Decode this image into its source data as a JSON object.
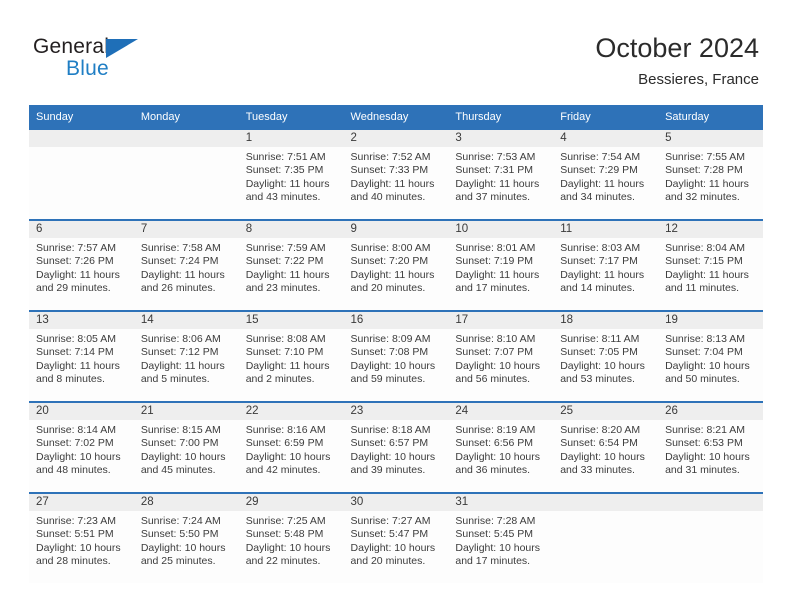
{
  "brand": {
    "name_top": "General",
    "name_bottom": "Blue",
    "triangle_color": "#1f6fb8",
    "blue_text_color": "#1f7ec4"
  },
  "header": {
    "title": "October 2024",
    "subtitle": "Bessieres, France"
  },
  "theme": {
    "header_blue": "#2e72b8",
    "row_divider": "#2e72b8",
    "daynum_band": "#eeeeee",
    "cell_bg": "#fdfdfd"
  },
  "weekday_headers": [
    "Sunday",
    "Monday",
    "Tuesday",
    "Wednesday",
    "Thursday",
    "Friday",
    "Saturday"
  ],
  "weeks": [
    [
      {
        "day": "",
        "empty": true
      },
      {
        "day": "",
        "empty": true
      },
      {
        "day": "1",
        "sunrise": "Sunrise: 7:51 AM",
        "sunset": "Sunset: 7:35 PM",
        "daylight1": "Daylight: 11 hours",
        "daylight2": "and 43 minutes."
      },
      {
        "day": "2",
        "sunrise": "Sunrise: 7:52 AM",
        "sunset": "Sunset: 7:33 PM",
        "daylight1": "Daylight: 11 hours",
        "daylight2": "and 40 minutes."
      },
      {
        "day": "3",
        "sunrise": "Sunrise: 7:53 AM",
        "sunset": "Sunset: 7:31 PM",
        "daylight1": "Daylight: 11 hours",
        "daylight2": "and 37 minutes."
      },
      {
        "day": "4",
        "sunrise": "Sunrise: 7:54 AM",
        "sunset": "Sunset: 7:29 PM",
        "daylight1": "Daylight: 11 hours",
        "daylight2": "and 34 minutes."
      },
      {
        "day": "5",
        "sunrise": "Sunrise: 7:55 AM",
        "sunset": "Sunset: 7:28 PM",
        "daylight1": "Daylight: 11 hours",
        "daylight2": "and 32 minutes."
      }
    ],
    [
      {
        "day": "6",
        "sunrise": "Sunrise: 7:57 AM",
        "sunset": "Sunset: 7:26 PM",
        "daylight1": "Daylight: 11 hours",
        "daylight2": "and 29 minutes."
      },
      {
        "day": "7",
        "sunrise": "Sunrise: 7:58 AM",
        "sunset": "Sunset: 7:24 PM",
        "daylight1": "Daylight: 11 hours",
        "daylight2": "and 26 minutes."
      },
      {
        "day": "8",
        "sunrise": "Sunrise: 7:59 AM",
        "sunset": "Sunset: 7:22 PM",
        "daylight1": "Daylight: 11 hours",
        "daylight2": "and 23 minutes."
      },
      {
        "day": "9",
        "sunrise": "Sunrise: 8:00 AM",
        "sunset": "Sunset: 7:20 PM",
        "daylight1": "Daylight: 11 hours",
        "daylight2": "and 20 minutes."
      },
      {
        "day": "10",
        "sunrise": "Sunrise: 8:01 AM",
        "sunset": "Sunset: 7:19 PM",
        "daylight1": "Daylight: 11 hours",
        "daylight2": "and 17 minutes."
      },
      {
        "day": "11",
        "sunrise": "Sunrise: 8:03 AM",
        "sunset": "Sunset: 7:17 PM",
        "daylight1": "Daylight: 11 hours",
        "daylight2": "and 14 minutes."
      },
      {
        "day": "12",
        "sunrise": "Sunrise: 8:04 AM",
        "sunset": "Sunset: 7:15 PM",
        "daylight1": "Daylight: 11 hours",
        "daylight2": "and 11 minutes."
      }
    ],
    [
      {
        "day": "13",
        "sunrise": "Sunrise: 8:05 AM",
        "sunset": "Sunset: 7:14 PM",
        "daylight1": "Daylight: 11 hours",
        "daylight2": "and 8 minutes."
      },
      {
        "day": "14",
        "sunrise": "Sunrise: 8:06 AM",
        "sunset": "Sunset: 7:12 PM",
        "daylight1": "Daylight: 11 hours",
        "daylight2": "and 5 minutes."
      },
      {
        "day": "15",
        "sunrise": "Sunrise: 8:08 AM",
        "sunset": "Sunset: 7:10 PM",
        "daylight1": "Daylight: 11 hours",
        "daylight2": "and 2 minutes."
      },
      {
        "day": "16",
        "sunrise": "Sunrise: 8:09 AM",
        "sunset": "Sunset: 7:08 PM",
        "daylight1": "Daylight: 10 hours",
        "daylight2": "and 59 minutes."
      },
      {
        "day": "17",
        "sunrise": "Sunrise: 8:10 AM",
        "sunset": "Sunset: 7:07 PM",
        "daylight1": "Daylight: 10 hours",
        "daylight2": "and 56 minutes."
      },
      {
        "day": "18",
        "sunrise": "Sunrise: 8:11 AM",
        "sunset": "Sunset: 7:05 PM",
        "daylight1": "Daylight: 10 hours",
        "daylight2": "and 53 minutes."
      },
      {
        "day": "19",
        "sunrise": "Sunrise: 8:13 AM",
        "sunset": "Sunset: 7:04 PM",
        "daylight1": "Daylight: 10 hours",
        "daylight2": "and 50 minutes."
      }
    ],
    [
      {
        "day": "20",
        "sunrise": "Sunrise: 8:14 AM",
        "sunset": "Sunset: 7:02 PM",
        "daylight1": "Daylight: 10 hours",
        "daylight2": "and 48 minutes."
      },
      {
        "day": "21",
        "sunrise": "Sunrise: 8:15 AM",
        "sunset": "Sunset: 7:00 PM",
        "daylight1": "Daylight: 10 hours",
        "daylight2": "and 45 minutes."
      },
      {
        "day": "22",
        "sunrise": "Sunrise: 8:16 AM",
        "sunset": "Sunset: 6:59 PM",
        "daylight1": "Daylight: 10 hours",
        "daylight2": "and 42 minutes."
      },
      {
        "day": "23",
        "sunrise": "Sunrise: 8:18 AM",
        "sunset": "Sunset: 6:57 PM",
        "daylight1": "Daylight: 10 hours",
        "daylight2": "and 39 minutes."
      },
      {
        "day": "24",
        "sunrise": "Sunrise: 8:19 AM",
        "sunset": "Sunset: 6:56 PM",
        "daylight1": "Daylight: 10 hours",
        "daylight2": "and 36 minutes."
      },
      {
        "day": "25",
        "sunrise": "Sunrise: 8:20 AM",
        "sunset": "Sunset: 6:54 PM",
        "daylight1": "Daylight: 10 hours",
        "daylight2": "and 33 minutes."
      },
      {
        "day": "26",
        "sunrise": "Sunrise: 8:21 AM",
        "sunset": "Sunset: 6:53 PM",
        "daylight1": "Daylight: 10 hours",
        "daylight2": "and 31 minutes."
      }
    ],
    [
      {
        "day": "27",
        "sunrise": "Sunrise: 7:23 AM",
        "sunset": "Sunset: 5:51 PM",
        "daylight1": "Daylight: 10 hours",
        "daylight2": "and 28 minutes."
      },
      {
        "day": "28",
        "sunrise": "Sunrise: 7:24 AM",
        "sunset": "Sunset: 5:50 PM",
        "daylight1": "Daylight: 10 hours",
        "daylight2": "and 25 minutes."
      },
      {
        "day": "29",
        "sunrise": "Sunrise: 7:25 AM",
        "sunset": "Sunset: 5:48 PM",
        "daylight1": "Daylight: 10 hours",
        "daylight2": "and 22 minutes."
      },
      {
        "day": "30",
        "sunrise": "Sunrise: 7:27 AM",
        "sunset": "Sunset: 5:47 PM",
        "daylight1": "Daylight: 10 hours",
        "daylight2": "and 20 minutes."
      },
      {
        "day": "31",
        "sunrise": "Sunrise: 7:28 AM",
        "sunset": "Sunset: 5:45 PM",
        "daylight1": "Daylight: 10 hours",
        "daylight2": "and 17 minutes."
      },
      {
        "day": "",
        "empty": true
      },
      {
        "day": "",
        "empty": true
      }
    ]
  ]
}
